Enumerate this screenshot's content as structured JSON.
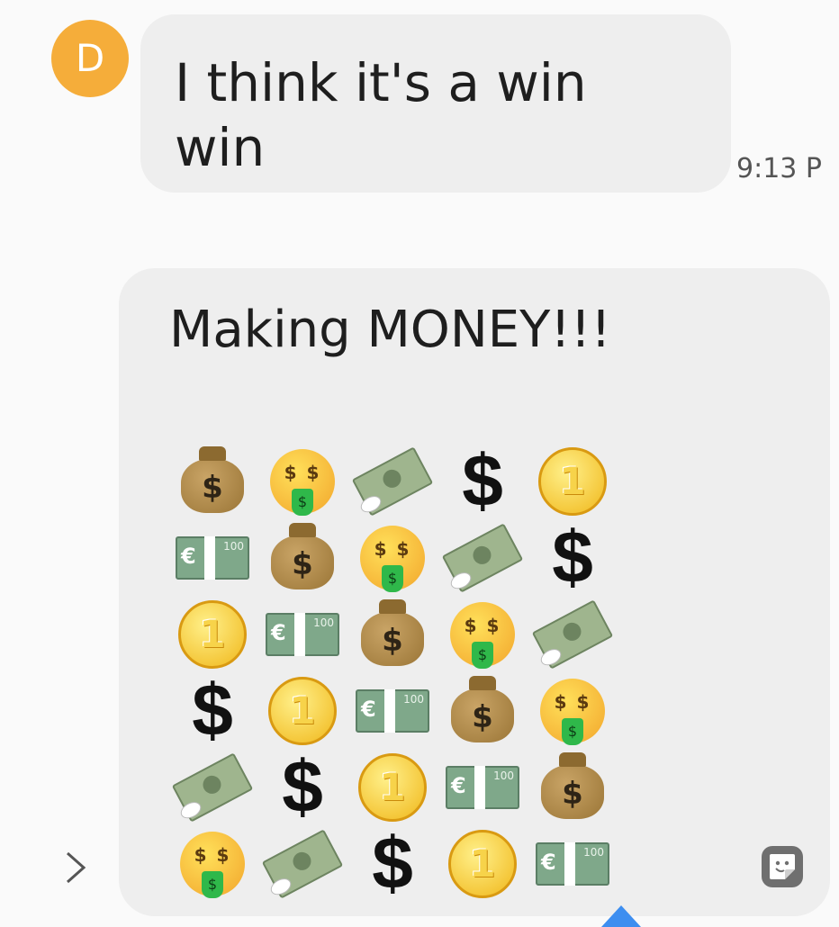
{
  "incoming_message": {
    "avatar_letter": "D",
    "avatar_color": "#f5ad3a",
    "text": "I think it's a win win",
    "time": "9:13 P"
  },
  "outgoing_message": {
    "title": "Making MONEY!!!",
    "emoji_grid": [
      [
        "money-bag",
        "money-mouth-face",
        "money-with-wings",
        "heavy-dollar-sign",
        "coin"
      ],
      [
        "euro-banknote",
        "money-bag",
        "money-mouth-face",
        "money-with-wings",
        "heavy-dollar-sign"
      ],
      [
        "coin",
        "euro-banknote",
        "money-bag",
        "money-mouth-face",
        "money-with-wings"
      ],
      [
        "heavy-dollar-sign",
        "coin",
        "euro-banknote",
        "money-bag",
        "money-mouth-face"
      ],
      [
        "money-with-wings",
        "heavy-dollar-sign",
        "coin",
        "euro-banknote",
        "money-bag"
      ],
      [
        "money-mouth-face",
        "money-with-wings",
        "heavy-dollar-sign",
        "coin",
        "euro-banknote"
      ]
    ]
  },
  "controls": {
    "expand_icon": "chevron-right-icon",
    "sticker_icon": "sticker-icon",
    "accent_color": "#3d8ef0"
  }
}
